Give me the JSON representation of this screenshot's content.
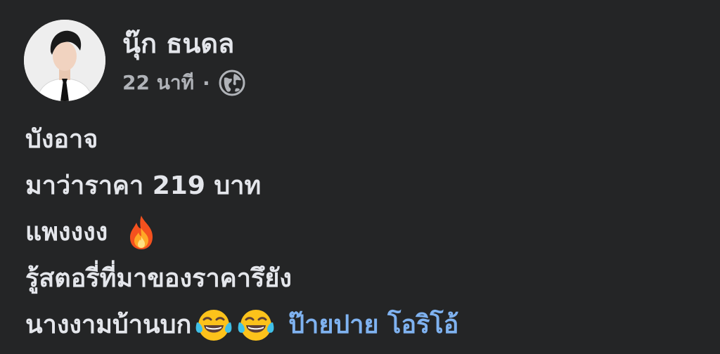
{
  "post": {
    "author_name": "นุ๊ก ธนดล",
    "timestamp": "22 นาที",
    "separator": "·",
    "audience_icon": "globe-icon",
    "lines": [
      "บังอาจ",
      "มาว่าราคา 219 บาท",
      "แพงงงง",
      "รู้สตอรี่ที่มาของราคารึยัง",
      "นางงามบ้านบก"
    ],
    "emojis": {
      "line3": "fire-emoji",
      "line5": [
        "tears-of-joy-emoji",
        "tears-of-joy-emoji"
      ]
    },
    "mention": "ป๊ายปาย โอริโอ้",
    "colors": {
      "background": "#242526",
      "primary_text": "#e4e6eb",
      "secondary_text": "#b0b3b8",
      "link": "#7fb2f0"
    }
  }
}
